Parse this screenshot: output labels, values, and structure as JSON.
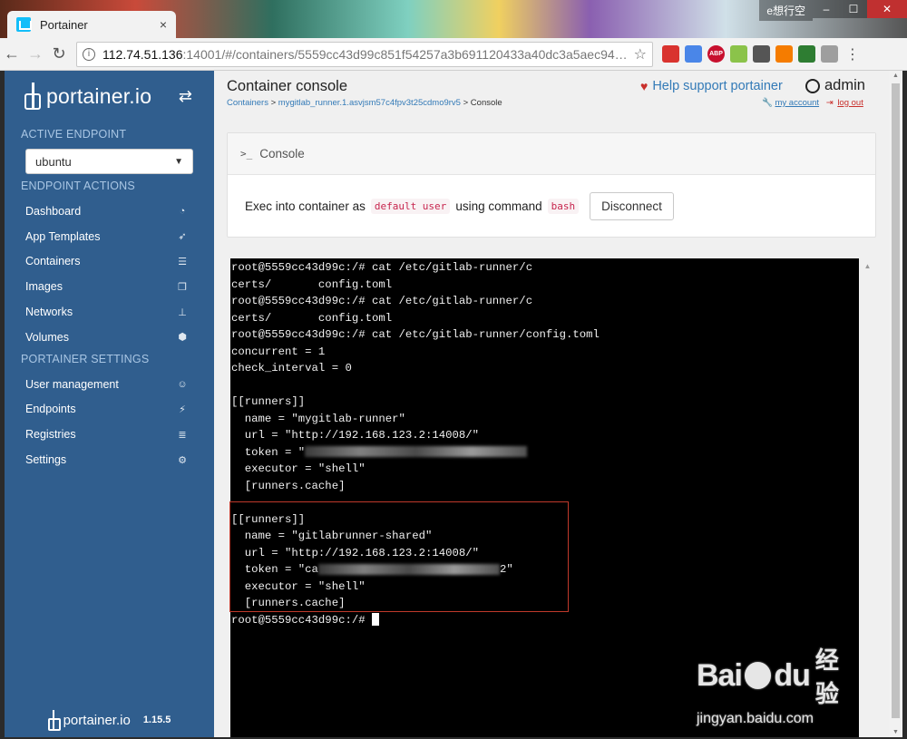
{
  "browser": {
    "tab_title": "Portainer",
    "tab_close": "×",
    "window_label": "e想行空",
    "url_host": "112.74.51.136",
    "url_rest": ":14001/#/containers/5559cc43d99c851f54257a3b691120433a40dc3a5aec942a...",
    "extensions": [
      {
        "name": "ext-1-icon",
        "color": "#d9332f"
      },
      {
        "name": "ext-translate-icon",
        "color": "#4a86e8"
      },
      {
        "name": "ext-abp-icon",
        "color": "#c8102e",
        "label": "ABP"
      },
      {
        "name": "ext-circle-icon",
        "color": "#8bc34a"
      },
      {
        "name": "ext-glasses-icon",
        "color": "#555555"
      },
      {
        "name": "ext-orange-icon",
        "color": "#f57c00"
      },
      {
        "name": "ext-green-icon",
        "color": "#2e7d32"
      },
      {
        "name": "ext-cloud-icon",
        "color": "#9e9e9e"
      }
    ]
  },
  "sidebar": {
    "brand": "portainer.io",
    "active_endpoint_label": "ACTIVE ENDPOINT",
    "endpoint": "ubuntu",
    "endpoint_actions_label": "ENDPOINT ACTIONS",
    "items": [
      {
        "label": "Dashboard",
        "icon": "tachometer-icon",
        "glyph": "◔"
      },
      {
        "label": "App Templates",
        "icon": "rocket-icon",
        "glyph": "➶"
      },
      {
        "label": "Containers",
        "icon": "list-icon",
        "glyph": "☰"
      },
      {
        "label": "Images",
        "icon": "clone-icon",
        "glyph": "❐"
      },
      {
        "label": "Networks",
        "icon": "sitemap-icon",
        "glyph": "⊥"
      },
      {
        "label": "Volumes",
        "icon": "cubes-icon",
        "glyph": "⬢"
      }
    ],
    "settings_label": "PORTAINER SETTINGS",
    "settings_items": [
      {
        "label": "User management",
        "icon": "users-icon",
        "glyph": "☺"
      },
      {
        "label": "Endpoints",
        "icon": "plug-icon",
        "glyph": "⚡"
      },
      {
        "label": "Registries",
        "icon": "database-icon",
        "glyph": "≣"
      },
      {
        "label": "Settings",
        "icon": "cogs-icon",
        "glyph": "⚙"
      }
    ],
    "footer_brand": "portainer.io",
    "version": "1.15.5"
  },
  "header": {
    "title": "Container console",
    "breadcrumb_containers": "Containers",
    "breadcrumb_container": "mygitlab_runner.1.asvjsm57c4fpv3t25cdmo9rv5",
    "breadcrumb_current": "> Console",
    "help": "Help support portainer",
    "username": "admin",
    "my_account": "my account",
    "logout": "log out"
  },
  "console": {
    "heading": "Console",
    "exec_prefix": "Exec into container as",
    "user_code": "default user",
    "using_text": "using command",
    "command_code": "bash",
    "disconnect_label": "Disconnect"
  },
  "terminal": {
    "lines": [
      "root@5559cc43d99c:/# cat /etc/gitlab-runner/c",
      "certs/       config.toml",
      "root@5559cc43d99c:/# cat /etc/gitlab-runner/c",
      "certs/       config.toml",
      "root@5559cc43d99c:/# cat /etc/gitlab-runner/config.toml",
      "concurrent = 1",
      "check_interval = 0",
      "",
      "[[runners]]",
      "  name = \"mygitlab-runner\"",
      "  url = \"http://192.168.123.2:14008/\"",
      "  token = \"",
      "  executor = \"shell\"",
      "  [runners.cache]",
      "",
      "[[runners]]",
      "  name = \"gitlabrunner-shared\"",
      "  url = \"http://192.168.123.2:14008/\"",
      "  token = \"ca",
      "  executor = \"shell\"",
      "  [runners.cache]",
      "root@5559cc43d99c:/# "
    ],
    "token2_suffix": "2\""
  },
  "watermark": {
    "logo_left": "Bai",
    "logo_right": "du",
    "logo_cn": "经验",
    "url": "jingyan.baidu.com"
  }
}
